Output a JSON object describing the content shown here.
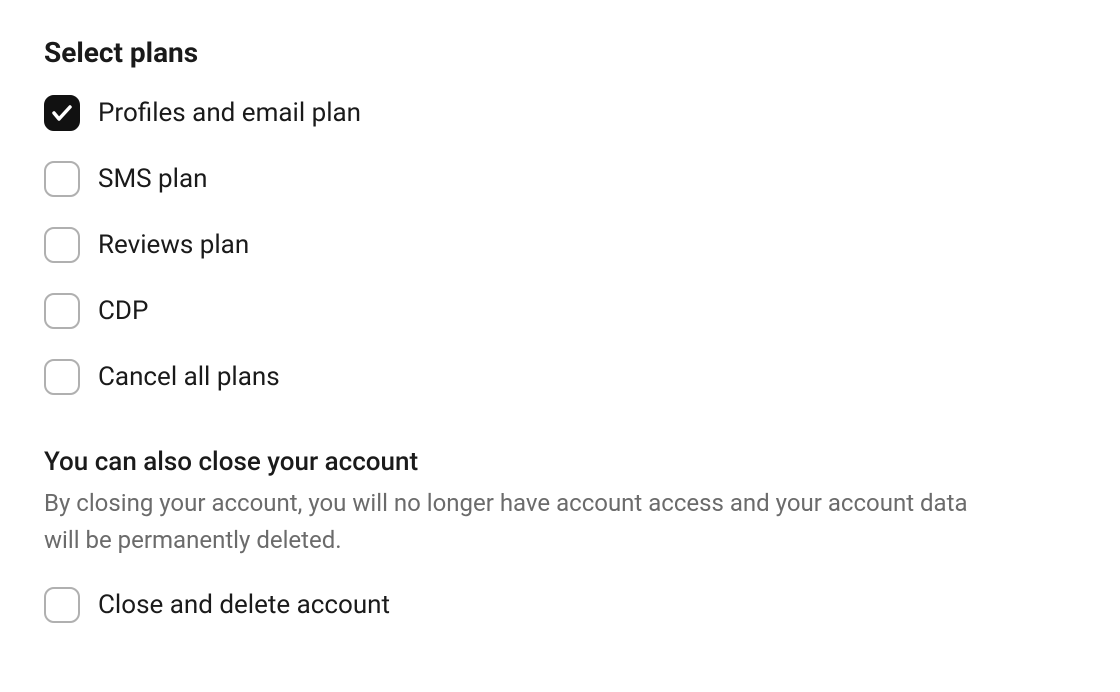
{
  "section1": {
    "title": "Select plans",
    "options": [
      {
        "label": "Profiles and email plan",
        "checked": true
      },
      {
        "label": "SMS plan",
        "checked": false
      },
      {
        "label": "Reviews plan",
        "checked": false
      },
      {
        "label": "CDP",
        "checked": false
      },
      {
        "label": "Cancel all plans",
        "checked": false
      }
    ]
  },
  "section2": {
    "title": "You can also close your account",
    "description": "By closing your account, you will no longer have account access and your account data will be permanently deleted.",
    "option": {
      "label": "Close and delete account",
      "checked": false
    }
  }
}
